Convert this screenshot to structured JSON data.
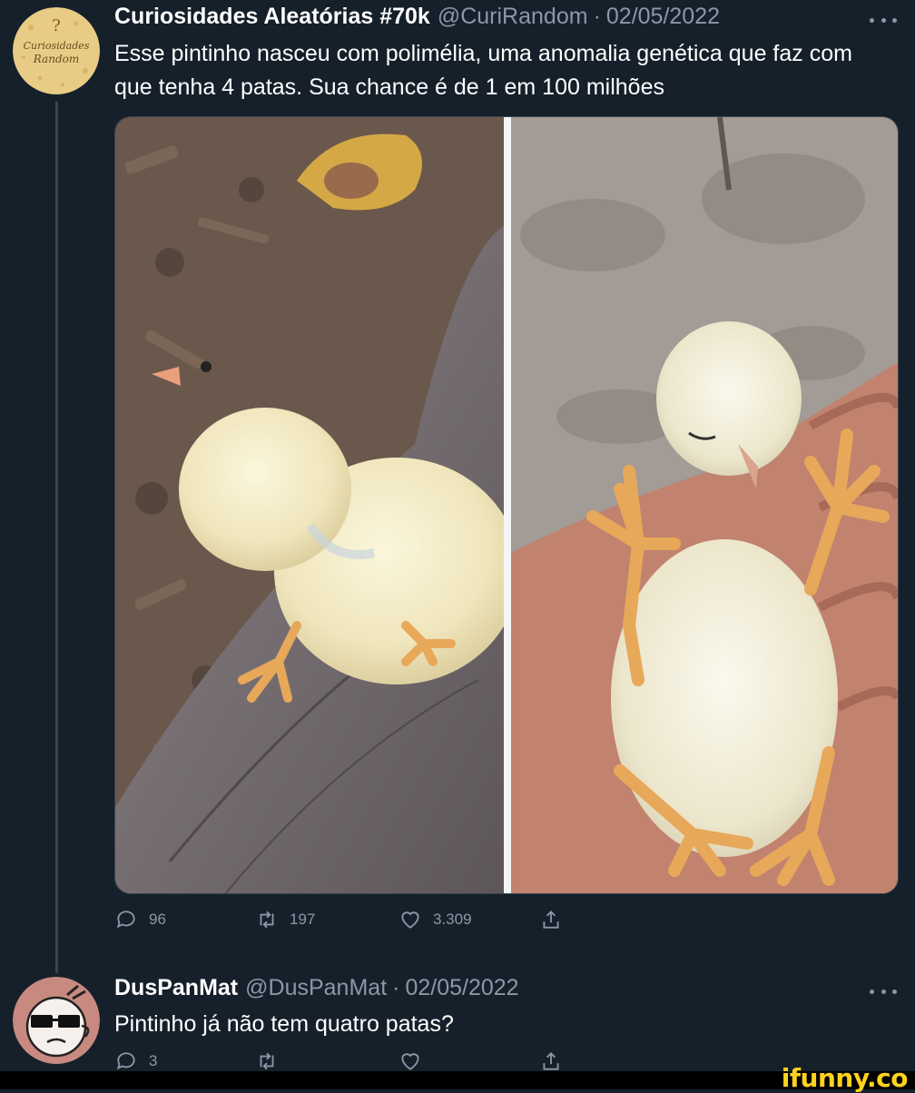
{
  "tweet1": {
    "display_name": "Curiosidades Aleatórias #70k",
    "handle": "@CuriRandom",
    "separator": "·",
    "date": "02/05/2022",
    "avatar_text_line1": "Curiosidades",
    "avatar_text_line2": "Random",
    "text": "Esse pintinho nasceu com polimélia, uma anomalia genética que faz com que tenha 4 patas. Sua chance é de 1 em 100 milhões",
    "replies": "96",
    "retweets": "197",
    "likes": "3.309"
  },
  "tweet2": {
    "display_name": "DusPanMat",
    "handle": "@DusPanMat",
    "separator": "·",
    "date": "02/05/2022",
    "text": "Pintinho já não tem quatro patas?",
    "replies": "3"
  },
  "watermark": "ifunny.co",
  "colors": {
    "background": "#15202b",
    "secondary_text": "#8b98a5",
    "watermark": "#ffd21f"
  },
  "icons": [
    "reply-icon",
    "retweet-icon",
    "like-icon",
    "share-icon",
    "more-icon"
  ]
}
